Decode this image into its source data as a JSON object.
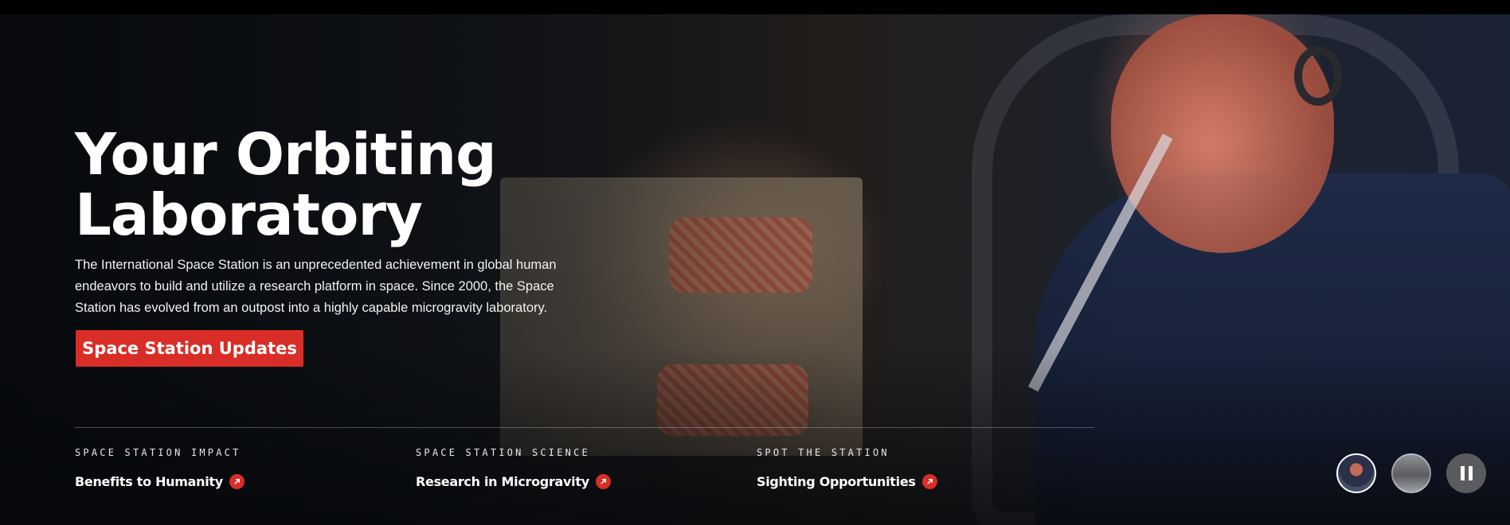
{
  "hero": {
    "title_line1": "Your Orbiting",
    "title_line2": "Laboratory",
    "description": "The International Space Station is an unprecedented achievement in global human endeavors to build and utilize a research platform in space. Since 2000, the Space Station has evolved from an outpost into a highly capable microgravity laboratory.",
    "cta_label": "Space Station Updates"
  },
  "features": [
    {
      "eyebrow": "SPACE STATION IMPACT",
      "link": "Benefits to Humanity"
    },
    {
      "eyebrow": "SPACE STATION SCIENCE",
      "link": "Research in Microgravity"
    },
    {
      "eyebrow": "SPOT THE STATION",
      "link": "Sighting Opportunities"
    }
  ],
  "controls": {
    "slides": [
      "slide-thumbnail-1",
      "slide-thumbnail-2"
    ],
    "pause_icon": "pause-icon"
  },
  "colors": {
    "accent": "#d92d27",
    "text": "#ffffff",
    "control_bg": "#5a5b5e"
  }
}
